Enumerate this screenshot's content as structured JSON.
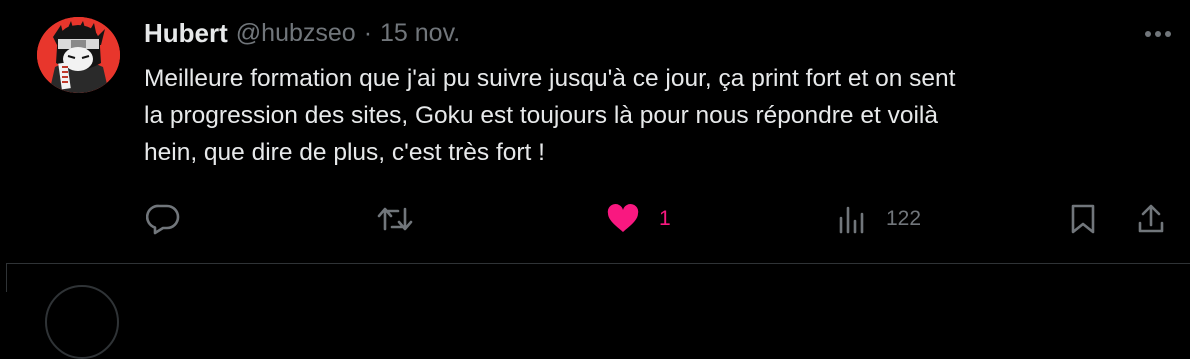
{
  "tweet": {
    "author_name": "Hubert",
    "handle": "@hubzseo",
    "separator": "·",
    "date": "15 nov.",
    "text_lines": [
      "Meilleure formation que j'ai pu suivre jusqu'à ce jour, ça print fort et on sent",
      "la progression des sites, Goku est toujours là pour nous répondre et voilà",
      "hein, que dire de plus, c'est très fort !"
    ],
    "like_count": "1",
    "view_count": "122",
    "liked": true
  },
  "colors": {
    "background": "#000000",
    "primary_text": "#e7e9ea",
    "secondary_text": "#71767b",
    "like": "#f91880",
    "avatar_bg": "#e8362c"
  },
  "icons": [
    "more-icon",
    "reply-icon",
    "retweet-icon",
    "heart-icon",
    "views-icon",
    "bookmark-icon",
    "share-icon"
  ]
}
